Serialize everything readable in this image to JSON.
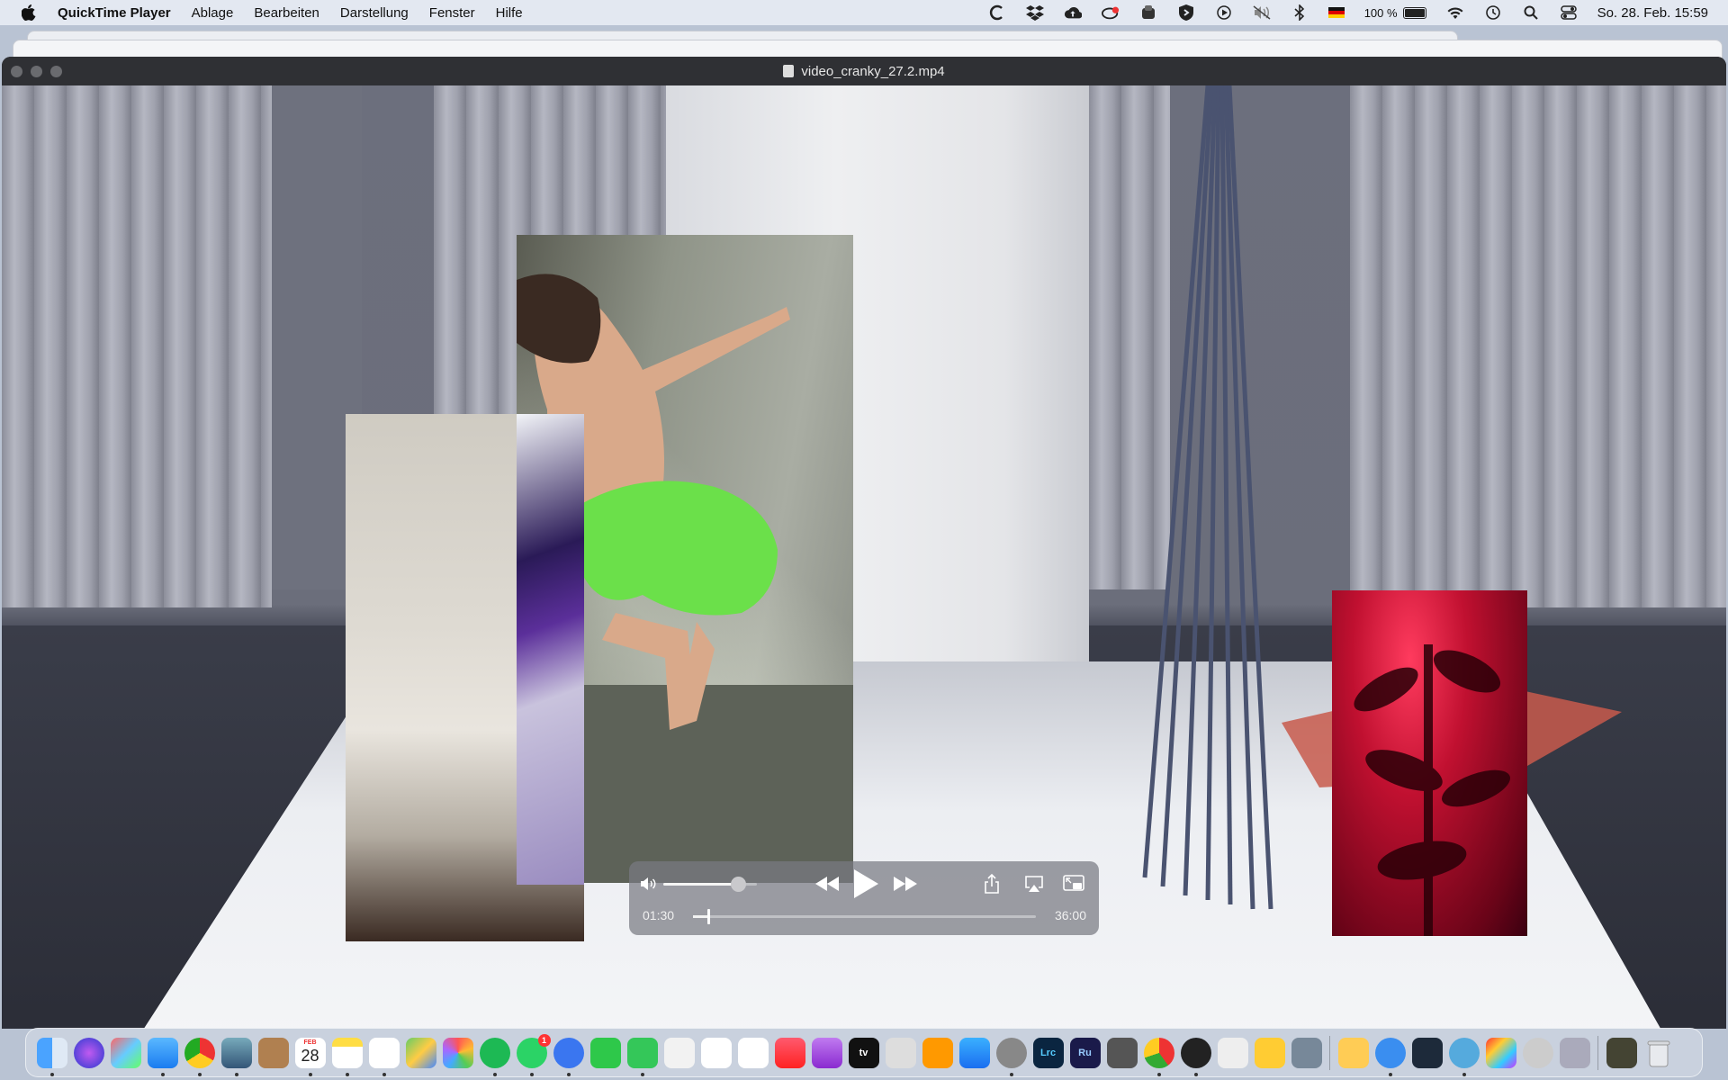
{
  "menubar": {
    "app_name": "QuickTime Player",
    "items": [
      "Ablage",
      "Bearbeiten",
      "Darstellung",
      "Fenster",
      "Hilfe"
    ],
    "battery_percent": "100 %",
    "clock": "So. 28. Feb.  15:59",
    "status_icons": [
      "cardhop-icon",
      "dropbox-icon",
      "cloud-upload-icon",
      "creative-cloud-icon",
      "vpn-icon",
      "bitwarden-icon",
      "play-icon",
      "mute-icon",
      "bluetooth-icon",
      "german-flag-icon",
      "battery-icon",
      "wifi-icon",
      "time-machine-icon",
      "spotlight-icon",
      "control-center-icon"
    ]
  },
  "window": {
    "title": "video_cranky_27.2.mp4"
  },
  "player": {
    "current_time": "01:30",
    "total_time": "36:00",
    "progress": 0.042,
    "volume": 0.8
  },
  "dock": {
    "calendar": {
      "month": "FEB",
      "day": "28"
    },
    "whatsapp_badge": "1",
    "lightroom_label": "Lrc",
    "rush_label": "Ru",
    "tv_label": "tv"
  },
  "colors": {
    "menubar_bg": "#e3e8f1",
    "titlebar_bg": "#2f3034",
    "controls_bg": "rgba(120,122,130,0.72)"
  }
}
